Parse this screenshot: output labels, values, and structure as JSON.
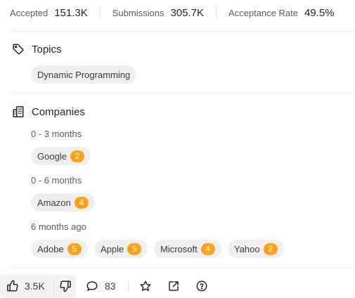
{
  "stats": [
    {
      "label": "Accepted",
      "value": "151.3K"
    },
    {
      "label": "Submissions",
      "value": "305.7K"
    },
    {
      "label": "Acceptance Rate",
      "value": "49.5%"
    }
  ],
  "topics": {
    "title": "Topics",
    "tags": [
      "Dynamic Programming"
    ]
  },
  "companies": {
    "title": "Companies",
    "groups": [
      {
        "period": "0 - 3 months",
        "items": [
          {
            "name": "Google",
            "count": "2"
          }
        ]
      },
      {
        "period": "0 - 6 months",
        "items": [
          {
            "name": "Amazon",
            "count": "4"
          }
        ]
      },
      {
        "period": "6 months ago",
        "items": [
          {
            "name": "Adobe",
            "count": "5"
          },
          {
            "name": "Apple",
            "count": "5"
          },
          {
            "name": "Microsoft",
            "count": "4"
          },
          {
            "name": "Yahoo",
            "count": "2"
          }
        ]
      }
    ]
  },
  "footer": {
    "likes": "3.5K",
    "comments": "83"
  },
  "icons": {
    "topics": "tag-icon",
    "companies": "building-icon",
    "like": "thumbs-up-icon",
    "dislike": "thumbs-down-icon",
    "comment": "comment-bubble-icon",
    "favorite": "star-icon",
    "share": "external-link-icon",
    "help": "question-circle-icon"
  },
  "colors": {
    "badge": "#ffa116",
    "chip_bg": "#efefef",
    "text": "#262626",
    "muted": "#5c5c5c"
  }
}
